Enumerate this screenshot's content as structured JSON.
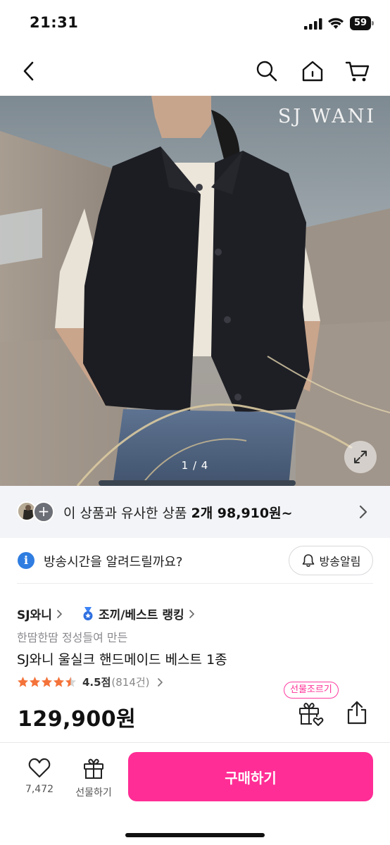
{
  "status_bar": {
    "time": "21:31",
    "battery": "59"
  },
  "nav": {
    "back_icon": "chevron-left-icon",
    "search_icon": "search-icon",
    "home_icon": "home-icon",
    "cart_icon": "cart-icon"
  },
  "hero": {
    "brand_watermark": "SJ WANI",
    "page_indicator": "1 / 4",
    "expand_icon": "expand-arrows-icon"
  },
  "similar": {
    "prefix": "이 상품과 유사한 상품 ",
    "highlight": "2개 98,910원~",
    "plus": "+"
  },
  "broadcast": {
    "text": "방송시간을 알려드릴까요?",
    "button_label": "방송알림",
    "info": "i"
  },
  "product": {
    "store": "SJ와니",
    "ranking": "조끼/베스트 랭킹",
    "subtitle": "한땀한땀 정성들여 만든",
    "title": "SJ와니 울실크 핸드메이드 베스트 1종",
    "rating": 4.5,
    "rating_label": "4.5점",
    "review_count": "(814건)",
    "price": "129,900원",
    "gift_badge": "선물조르기"
  },
  "bottom_bar": {
    "like_count": "7,472",
    "gift_label": "선물하기",
    "buy_label": "구매하기"
  },
  "colors": {
    "accent": "#ff2d95",
    "star": "#f4733a",
    "info_blue": "#2f7de1"
  }
}
